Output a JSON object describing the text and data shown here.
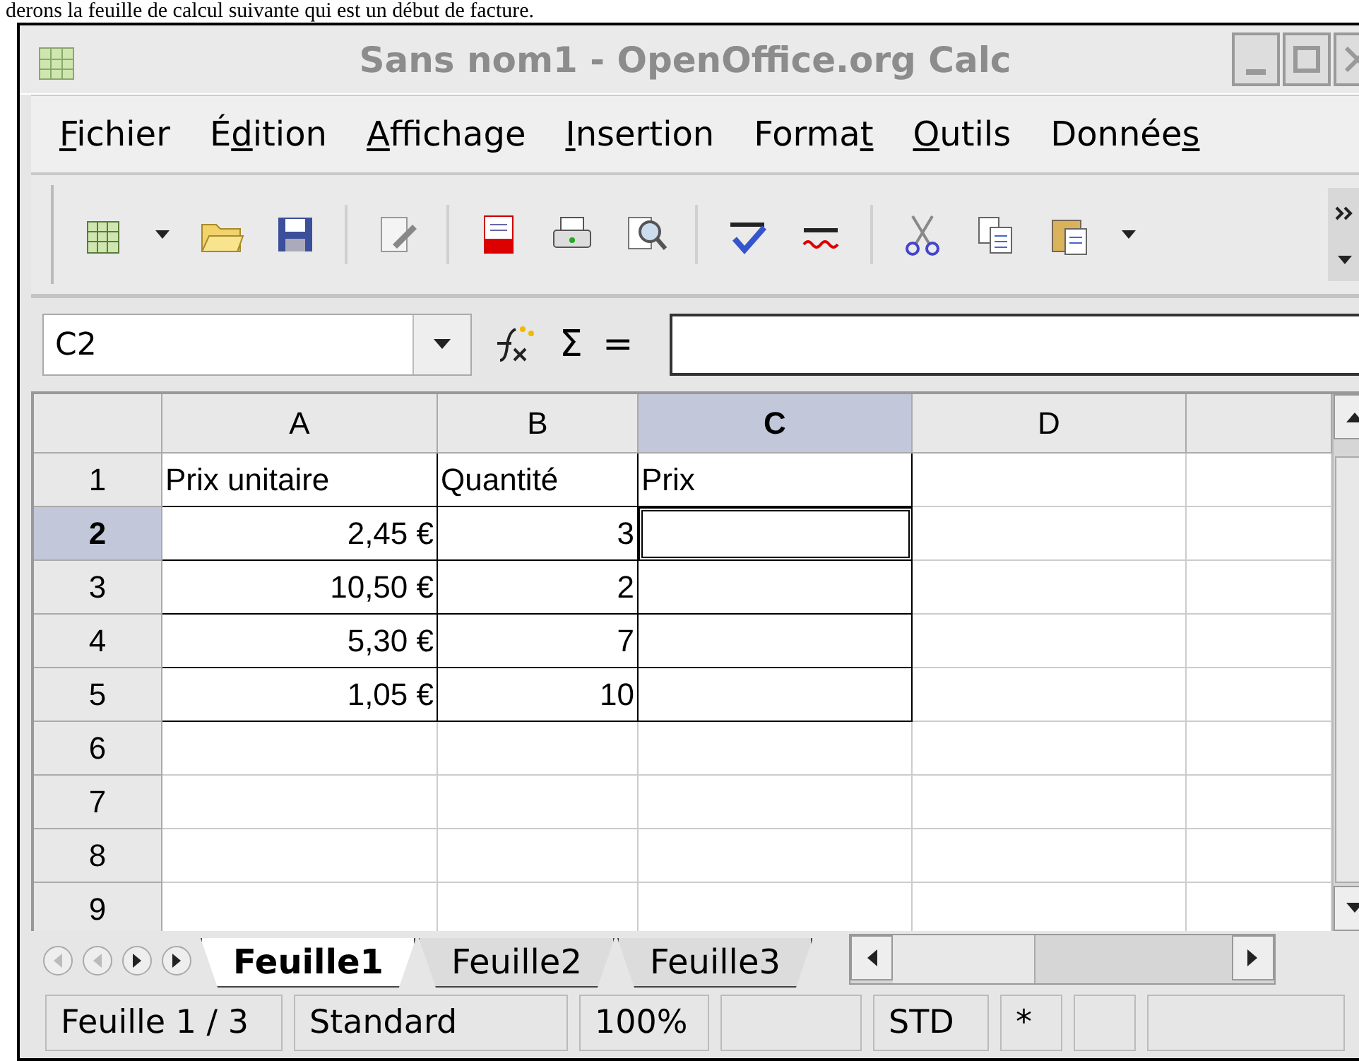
{
  "caption": "derons la feuille de calcul suivante qui est un début de facture.",
  "window": {
    "title": "Sans nom1 - OpenOffice.org Calc"
  },
  "menu": [
    {
      "key": "F",
      "post": "ichier"
    },
    {
      "pre": "É",
      "key": "d",
      "post": "ition"
    },
    {
      "key": "A",
      "post": "ffichage"
    },
    {
      "key": "I",
      "post": "nsertion"
    },
    {
      "pre": "Forma",
      "key": "t"
    },
    {
      "key": "O",
      "post": "utils"
    },
    {
      "pre": "Donnée",
      "key": "s"
    }
  ],
  "formula_bar": {
    "name_box": "C2",
    "sum": "Σ",
    "equals": "="
  },
  "grid": {
    "columns": [
      {
        "label": "A",
        "selected": false
      },
      {
        "label": "B",
        "selected": false
      },
      {
        "label": "C",
        "selected": true
      },
      {
        "label": "D",
        "selected": false
      }
    ],
    "rows": [
      {
        "label": "1",
        "selected": false,
        "cells": [
          {
            "t": "Prix unitaire",
            "kind": "text",
            "bordered": true,
            "selected": false
          },
          {
            "t": "Quantité",
            "kind": "text",
            "bordered": true,
            "selected": false
          },
          {
            "t": "Prix",
            "kind": "text",
            "bordered": true,
            "selected": false
          },
          {
            "kind": "empty",
            "bordered": false,
            "selected": false
          }
        ]
      },
      {
        "label": "2",
        "selected": true,
        "cells": [
          {
            "t": "2,45 €",
            "kind": "number",
            "bordered": true,
            "selected": false
          },
          {
            "t": "3",
            "kind": "number",
            "bordered": true,
            "selected": false
          },
          {
            "kind": "empty",
            "bordered": true,
            "selected": true
          },
          {
            "kind": "empty",
            "bordered": false,
            "selected": false
          }
        ]
      },
      {
        "label": "3",
        "selected": false,
        "cells": [
          {
            "t": "10,50 €",
            "kind": "number",
            "bordered": true,
            "selected": false
          },
          {
            "t": "2",
            "kind": "number",
            "bordered": true,
            "selected": false
          },
          {
            "kind": "empty",
            "bordered": true,
            "selected": false
          },
          {
            "kind": "empty",
            "bordered": false,
            "selected": false
          }
        ]
      },
      {
        "label": "4",
        "selected": false,
        "cells": [
          {
            "t": "5,30 €",
            "kind": "number",
            "bordered": true,
            "selected": false
          },
          {
            "t": "7",
            "kind": "number",
            "bordered": true,
            "selected": false
          },
          {
            "kind": "empty",
            "bordered": true,
            "selected": false
          },
          {
            "kind": "empty",
            "bordered": false,
            "selected": false
          }
        ]
      },
      {
        "label": "5",
        "selected": false,
        "cells": [
          {
            "t": "1,05 €",
            "kind": "number",
            "bordered": true,
            "selected": false
          },
          {
            "t": "10",
            "kind": "number",
            "bordered": true,
            "selected": false
          },
          {
            "kind": "empty",
            "bordered": true,
            "selected": false
          },
          {
            "kind": "empty",
            "bordered": false,
            "selected": false
          }
        ]
      },
      {
        "label": "6",
        "selected": false,
        "cells": [
          {
            "kind": "empty",
            "bordered": false,
            "selected": false
          },
          {
            "kind": "empty",
            "bordered": false,
            "selected": false
          },
          {
            "kind": "empty",
            "bordered": false,
            "selected": false
          },
          {
            "kind": "empty",
            "bordered": false,
            "selected": false
          }
        ]
      },
      {
        "label": "7",
        "selected": false,
        "cells": [
          {
            "kind": "empty",
            "bordered": false,
            "selected": false
          },
          {
            "kind": "empty",
            "bordered": false,
            "selected": false
          },
          {
            "kind": "empty",
            "bordered": false,
            "selected": false
          },
          {
            "kind": "empty",
            "bordered": false,
            "selected": false
          }
        ]
      },
      {
        "label": "8",
        "selected": false,
        "cells": [
          {
            "kind": "empty",
            "bordered": false,
            "selected": false
          },
          {
            "kind": "empty",
            "bordered": false,
            "selected": false
          },
          {
            "kind": "empty",
            "bordered": false,
            "selected": false
          },
          {
            "kind": "empty",
            "bordered": false,
            "selected": false
          }
        ]
      },
      {
        "label": "9",
        "selected": false,
        "cells": [
          {
            "kind": "empty",
            "bordered": false,
            "selected": false
          },
          {
            "kind": "empty",
            "bordered": false,
            "selected": false
          },
          {
            "kind": "empty",
            "bordered": false,
            "selected": false
          },
          {
            "kind": "empty",
            "bordered": false,
            "selected": false
          }
        ]
      }
    ]
  },
  "sheet_tabs": [
    {
      "label": "Feuille1",
      "selected": true
    },
    {
      "label": "Feuille2",
      "selected": false
    },
    {
      "label": "Feuille3",
      "selected": false
    }
  ],
  "status_bar": [
    {
      "kind": "text",
      "text": "Feuille 1 / 3"
    },
    {
      "kind": "text",
      "text": "Standard"
    },
    {
      "kind": "text",
      "text": "100%"
    },
    {
      "kind": "blank"
    },
    {
      "kind": "text",
      "text": "STD"
    },
    {
      "kind": "text",
      "text": "*"
    },
    {
      "kind": "blank"
    },
    {
      "kind": "blank"
    }
  ]
}
